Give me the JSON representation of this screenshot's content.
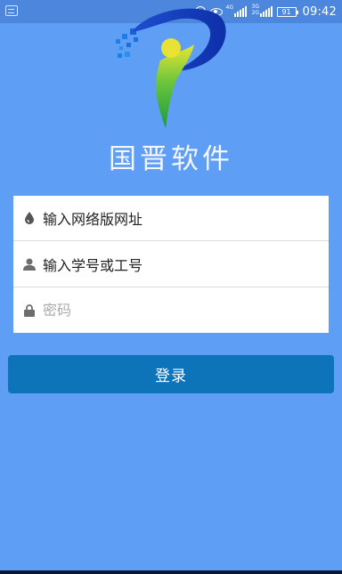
{
  "status_bar": {
    "network_1": "4G",
    "network_2": "3G",
    "network_3": "2G",
    "battery": "91",
    "time": "09:42",
    "icons": [
      "app-notification-icon",
      "alarm-icon",
      "eye-icon",
      "signal-icon",
      "signal-icon",
      "battery-icon"
    ]
  },
  "brand": {
    "app_title": "国晋软件",
    "colors": {
      "background": "#5f9ef5",
      "logo_blue": "#1d4fc9",
      "logo_green": "#2fb34a",
      "logo_yellow": "#e8e233",
      "button": "#0d74b9"
    }
  },
  "form": {
    "url_field": {
      "value": "输入网络版网址",
      "icon": "drop-icon"
    },
    "user_field": {
      "value": "输入学号或工号",
      "icon": "user-icon"
    },
    "password_field": {
      "placeholder": "密码",
      "icon": "lock-icon"
    }
  },
  "login_button": {
    "label": "登录"
  }
}
